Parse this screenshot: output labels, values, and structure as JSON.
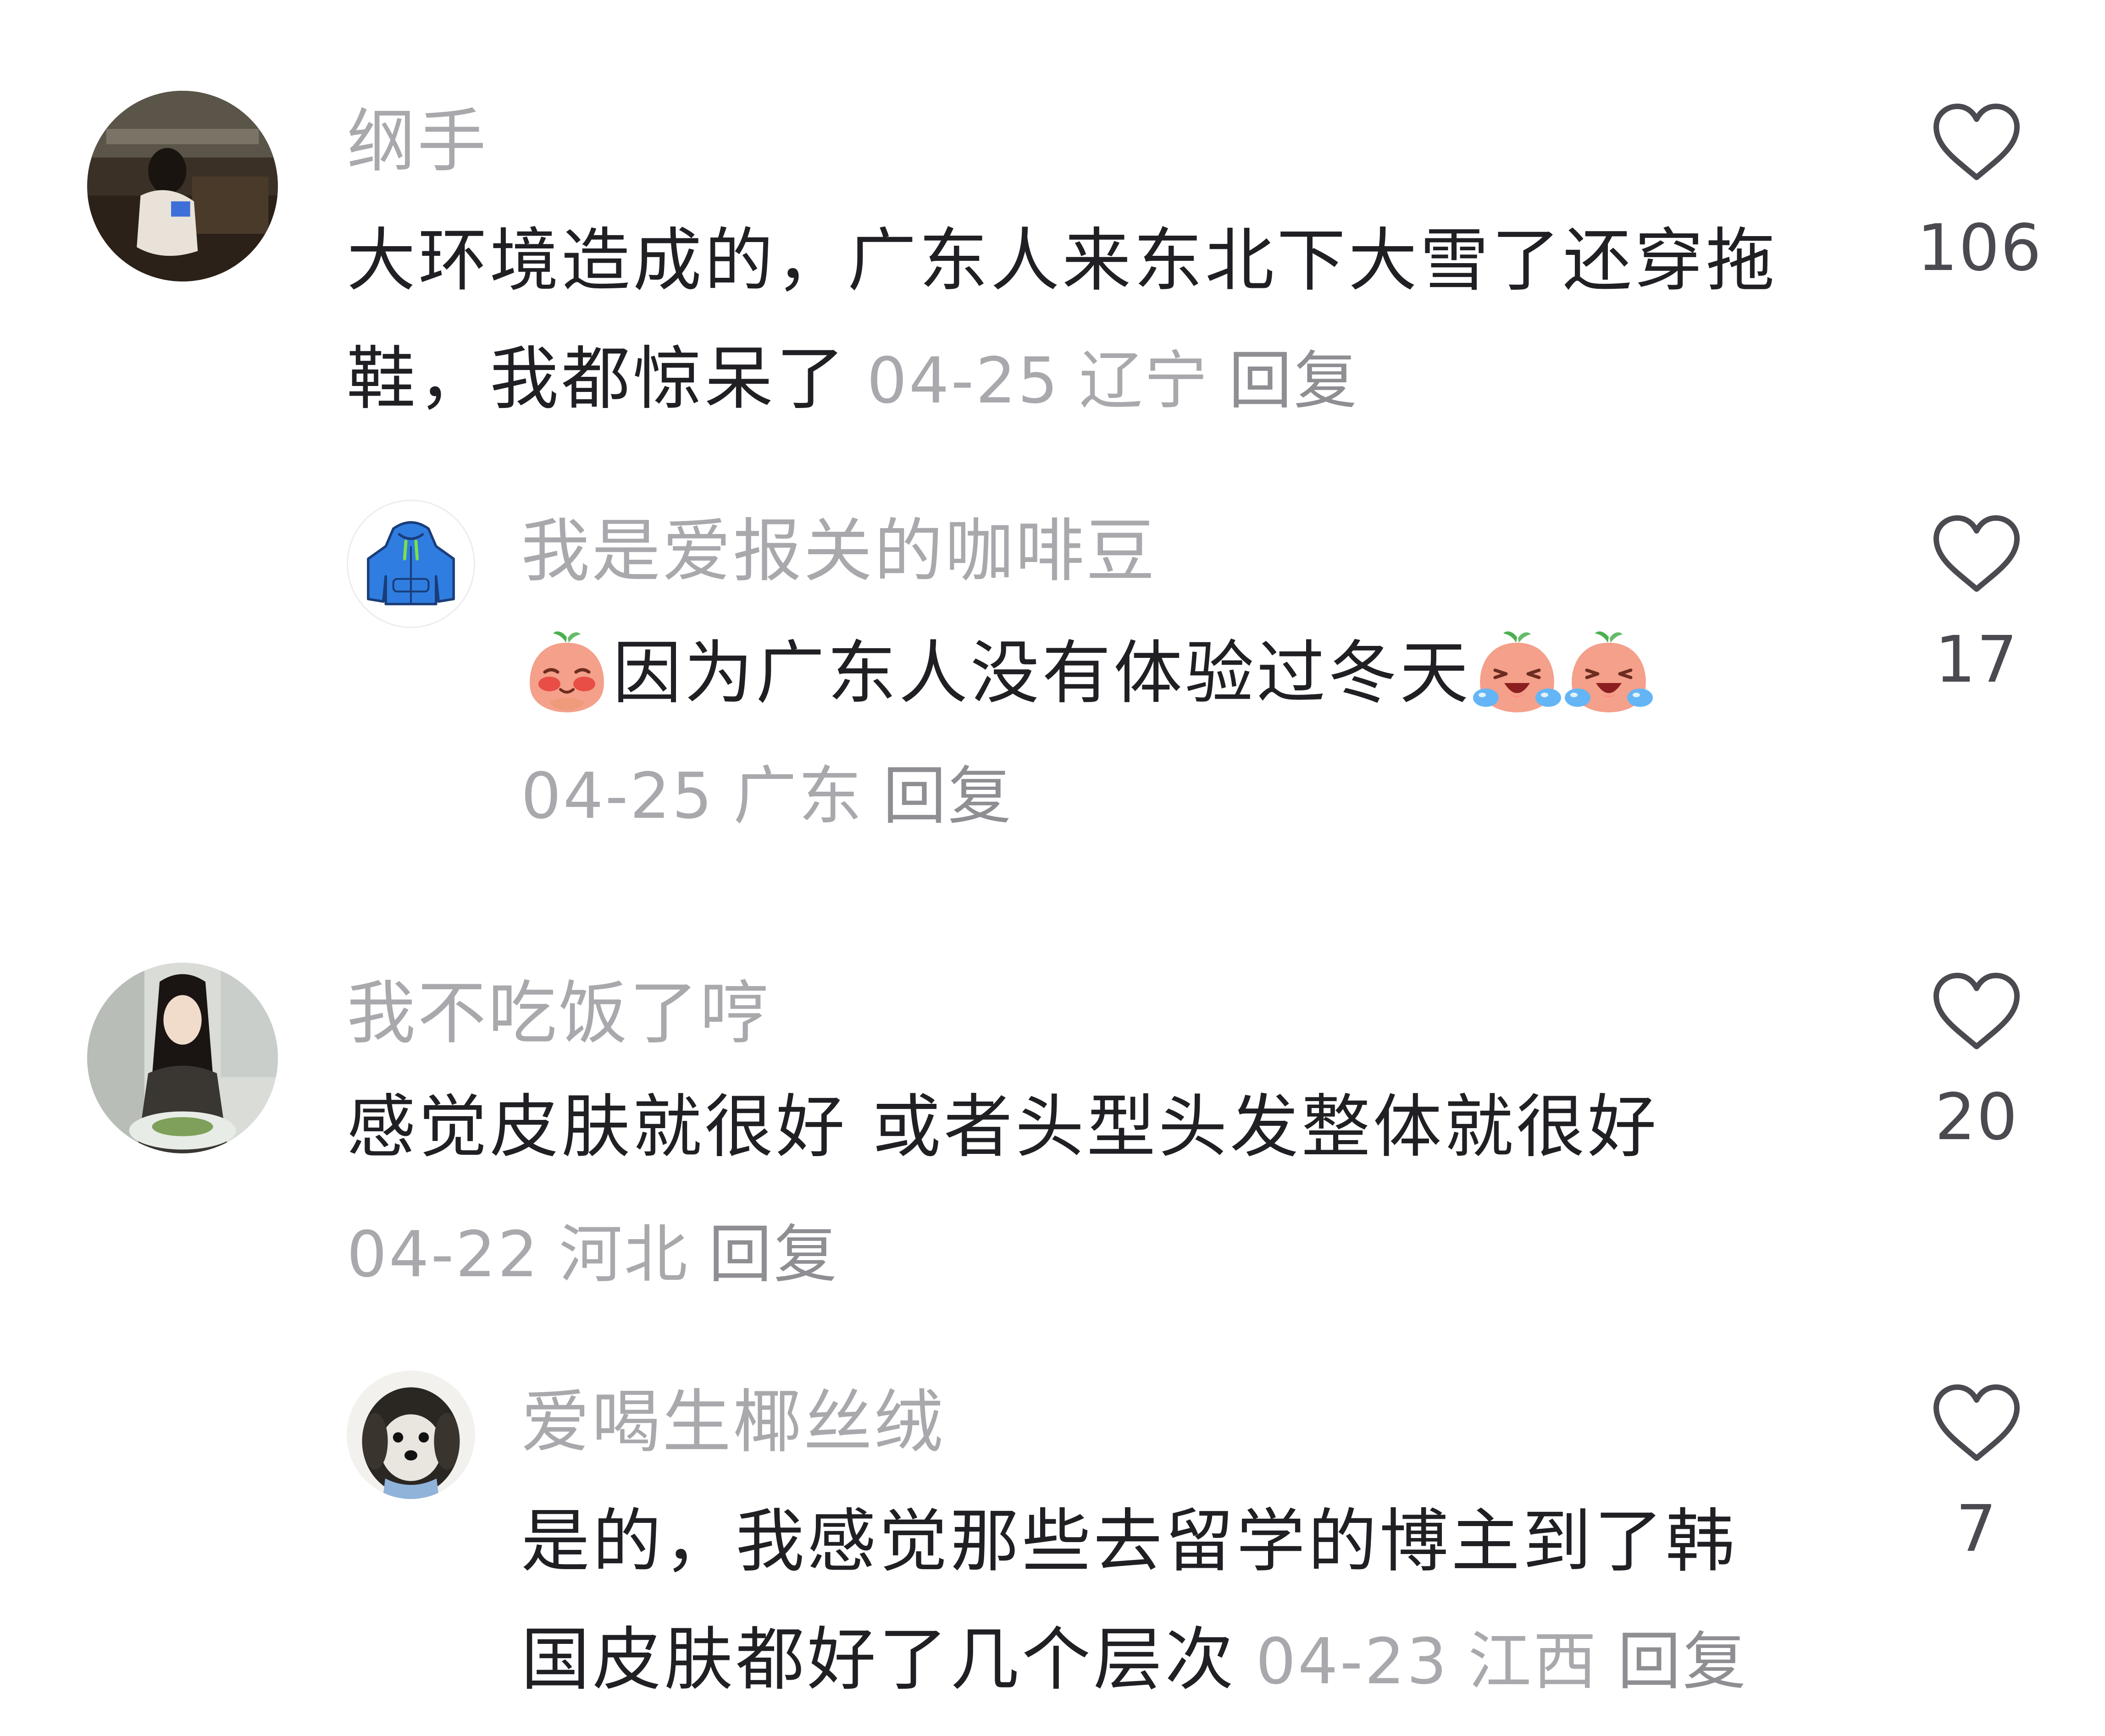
{
  "comments": [
    {
      "username": "纲手",
      "text": "大环境造成的，广东人来东北下大雪了还穿拖鞋，我都惊呆了",
      "date": "04-25",
      "location": "辽宁",
      "reply_label": "回复",
      "likes": "106",
      "avatar_icon": "photo-woman-sitting"
    },
    {
      "username": "我是爱报关的咖啡豆",
      "text": "因为广东人没有体验过冬天",
      "emoji_before": [
        "shy-peach-emoji"
      ],
      "emoji_after": [
        "crying-laugh-peach-emoji",
        "crying-laugh-peach-emoji"
      ],
      "date": "04-25",
      "location": "广东",
      "reply_label": "回复",
      "likes": "17",
      "avatar_icon": "blue-hoodie-icon"
    },
    {
      "username": "我不吃饭了哼",
      "text": "感觉皮肤就很好 或者头型头发整体就很好",
      "date": "04-22",
      "location": "河北",
      "reply_label": "回复",
      "likes": "20",
      "avatar_icon": "photo-woman-dining"
    },
    {
      "username": "爱喝生椰丝绒",
      "text": "是的，我感觉那些去留学的博主到了韩国皮肤都好了几个层次",
      "date": "04-23",
      "location": "江西",
      "reply_label": "回复",
      "likes": "7",
      "avatar_icon": "photo-dog"
    }
  ],
  "colors": {
    "text": "#1f1f24",
    "muted": "#a9a9ad",
    "count": "#4a4a50"
  }
}
